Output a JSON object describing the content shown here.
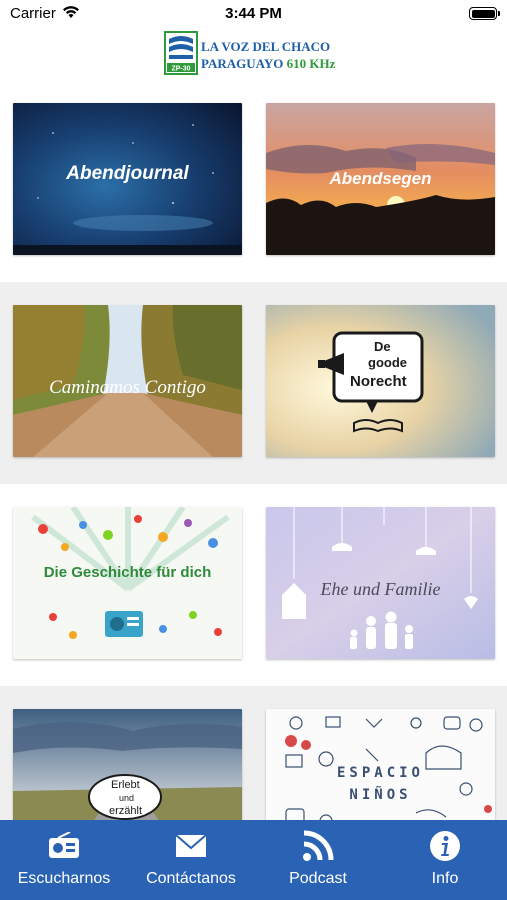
{
  "status_bar": {
    "carrier": "Carrier",
    "time": "3:44 PM"
  },
  "header": {
    "logo_mark": "ZP-30",
    "logo_line1": "LA VOZ DEL CHACO",
    "logo_line2": "PARAGUAYO",
    "logo_freq": "610 KHz"
  },
  "programs": [
    {
      "title": "Abendjournal"
    },
    {
      "title": "Abendsegen"
    },
    {
      "title": "Caminamos Contigo"
    },
    {
      "title_line1": "De",
      "title_line2": "goode",
      "title_line3": "Norecht"
    },
    {
      "title": "Die Geschichte für dich"
    },
    {
      "title": "Ehe und Familie"
    },
    {
      "title_line1": "Erlebt",
      "title_line2": "und",
      "title_line3": "erzählt"
    },
    {
      "title_line1": "ESPACIO",
      "title_line2": "NIÑOS"
    }
  ],
  "tabbar": {
    "tabs": [
      {
        "label": "Escucharnos",
        "icon": "radio-icon"
      },
      {
        "label": "Contáctanos",
        "icon": "mail-icon"
      },
      {
        "label": "Podcast",
        "icon": "rss-icon"
      },
      {
        "label": "Info",
        "icon": "info-icon"
      }
    ],
    "color": "#2b63b4"
  }
}
